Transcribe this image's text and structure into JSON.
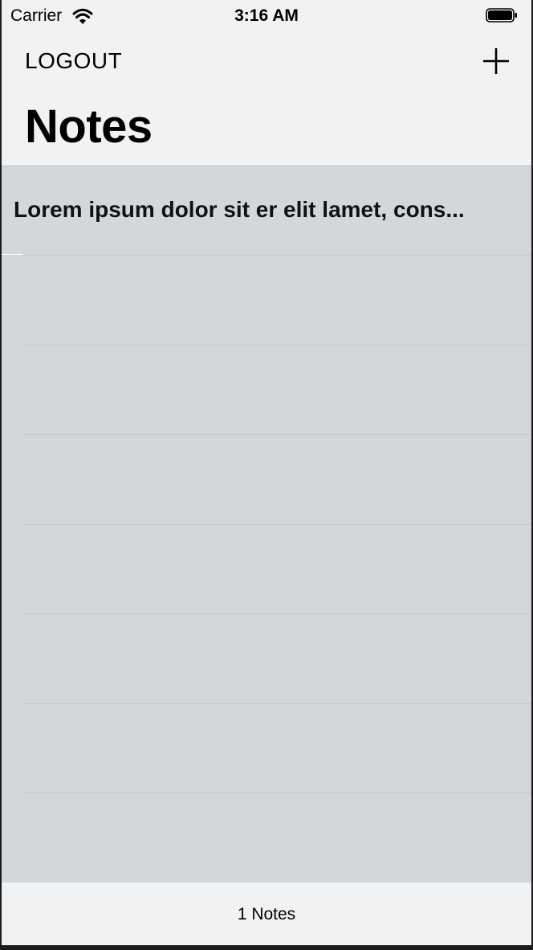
{
  "status_bar": {
    "carrier": "Carrier",
    "time": "3:16 AM",
    "icons": [
      "wifi-icon",
      "battery-icon"
    ]
  },
  "nav": {
    "left_button": "LOGOUT",
    "right_icon": "plus-icon",
    "title": "Notes"
  },
  "notes": [
    {
      "title": "Lorem ipsum dolor sit er elit lamet, cons..."
    }
  ],
  "toolbar": {
    "count_label": "1 Notes"
  },
  "colors": {
    "bar_background": "#f1f2f3",
    "list_background": "#d3d7db",
    "separator": "#c4c8cc"
  }
}
